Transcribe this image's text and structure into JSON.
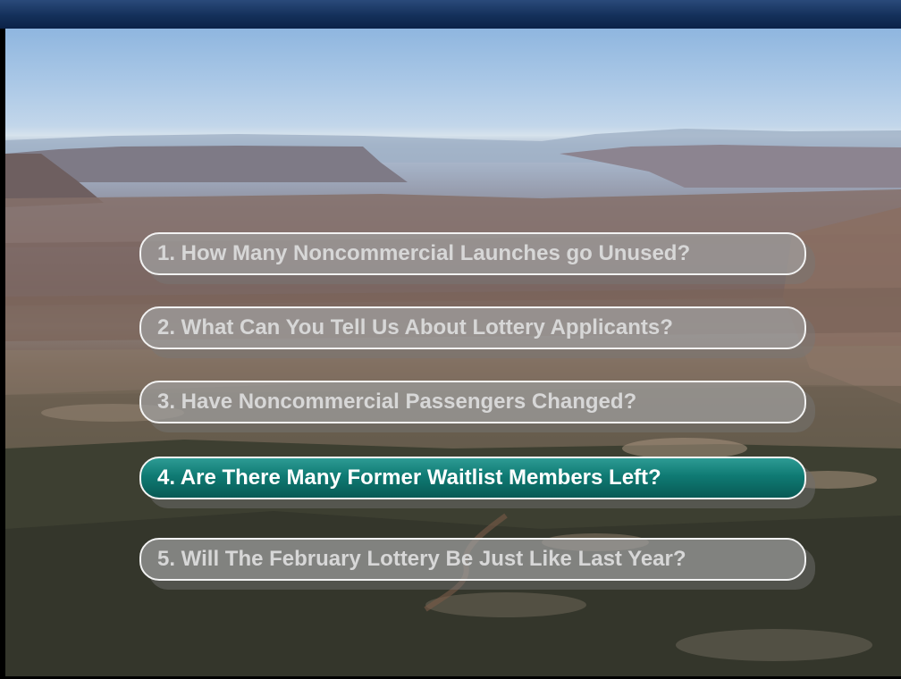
{
  "slide": {
    "background_photo": "canyon-landscape-photo",
    "accent_colors": {
      "title_bar": "#14305a",
      "active_item": "#0f7a73",
      "inactive_item": "#a0a0a0",
      "item_border": "#f2f2f2"
    }
  },
  "menu": {
    "items": [
      {
        "label": "1. How Many Noncommercial Launches go Unused?",
        "state": "inactive"
      },
      {
        "label": "2. What Can You Tell Us About Lottery Applicants?",
        "state": "inactive"
      },
      {
        "label": "3. Have Noncommercial Passengers Changed?",
        "state": "inactive"
      },
      {
        "label": "4. Are There Many Former Waitlist Members Left?",
        "state": "active"
      },
      {
        "label": "5. Will The February Lottery Be Just Like Last Year?",
        "state": "inactive"
      }
    ]
  }
}
